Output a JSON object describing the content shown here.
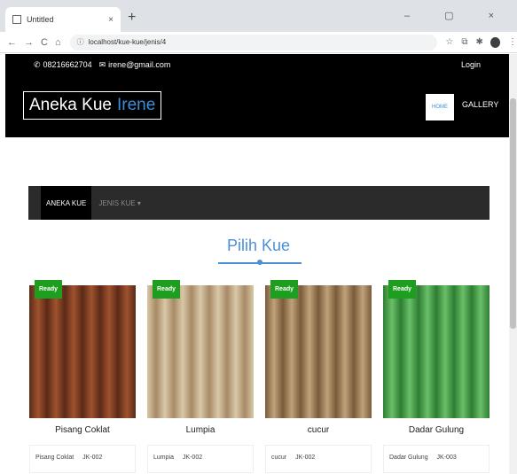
{
  "browser": {
    "tab_title": "Untitled",
    "tab_close": "×",
    "new_tab": "+",
    "window_controls": "–  ▢  ×",
    "url": "localhost/kue-kue/jenis/4",
    "nav": [
      "←",
      "→",
      "C",
      "⌂"
    ]
  },
  "topinfo": {
    "phone": "08216662704",
    "email": "irene@gmail.com",
    "login": "Login"
  },
  "header": {
    "brand_main": "Aneka Kue",
    "brand_accent": "Irene",
    "nav_home": "HOME",
    "nav_gallery": "GALLERY"
  },
  "category_bar": {
    "active": "ANEKA KUE",
    "dropdown": "JENIS KUE ▾"
  },
  "section": {
    "title": "Pilih Kue"
  },
  "products": [
    {
      "badge": "Ready",
      "name": "Pisang Coklat",
      "info_name": "Pisang Coklat",
      "info_code": "JK-002",
      "colors": [
        "#5a2a18",
        "#a0522d"
      ]
    },
    {
      "badge": "Ready",
      "name": "Lumpia",
      "info_name": "Lumpia",
      "info_code": "JK-002",
      "colors": [
        "#d8c8a8",
        "#a88a66"
      ]
    },
    {
      "badge": "Ready",
      "name": "cucur",
      "info_name": "cucur",
      "info_code": "JK-002",
      "colors": [
        "#7a5a3a",
        "#c0a27a"
      ]
    },
    {
      "badge": "Ready",
      "name": "Dadar Gulung",
      "info_name": "Dadar Gulung",
      "info_code": "JK-003",
      "colors": [
        "#2e7d32",
        "#6abf69"
      ]
    }
  ]
}
